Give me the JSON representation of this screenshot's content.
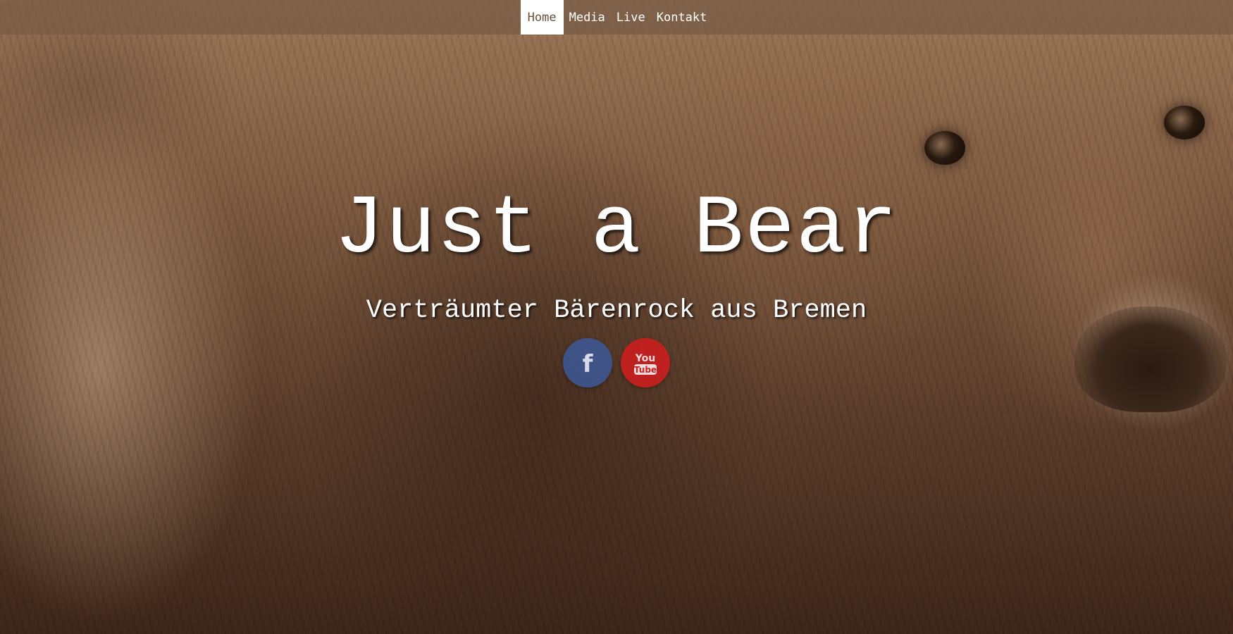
{
  "nav": {
    "items": [
      {
        "label": "Home",
        "active": true
      },
      {
        "label": "Media",
        "active": false
      },
      {
        "label": "Live",
        "active": false
      },
      {
        "label": "Kontakt",
        "active": false
      }
    ]
  },
  "hero": {
    "title": "Just a Bear",
    "subtitle": "Verträumter Bärenrock aus Bremen"
  },
  "social": {
    "facebook": {
      "icon": "facebook-icon",
      "glyph": "f",
      "color": "#3c5898"
    },
    "youtube": {
      "icon": "youtube-icon",
      "logo_top": "You",
      "logo_bottom": "Tube",
      "color": "#cd1e1e"
    }
  },
  "colors": {
    "nav_bg": "#785c46",
    "nav_active_bg": "#ffffff",
    "nav_active_text": "#6b4f3a",
    "text": "#ffffff"
  }
}
